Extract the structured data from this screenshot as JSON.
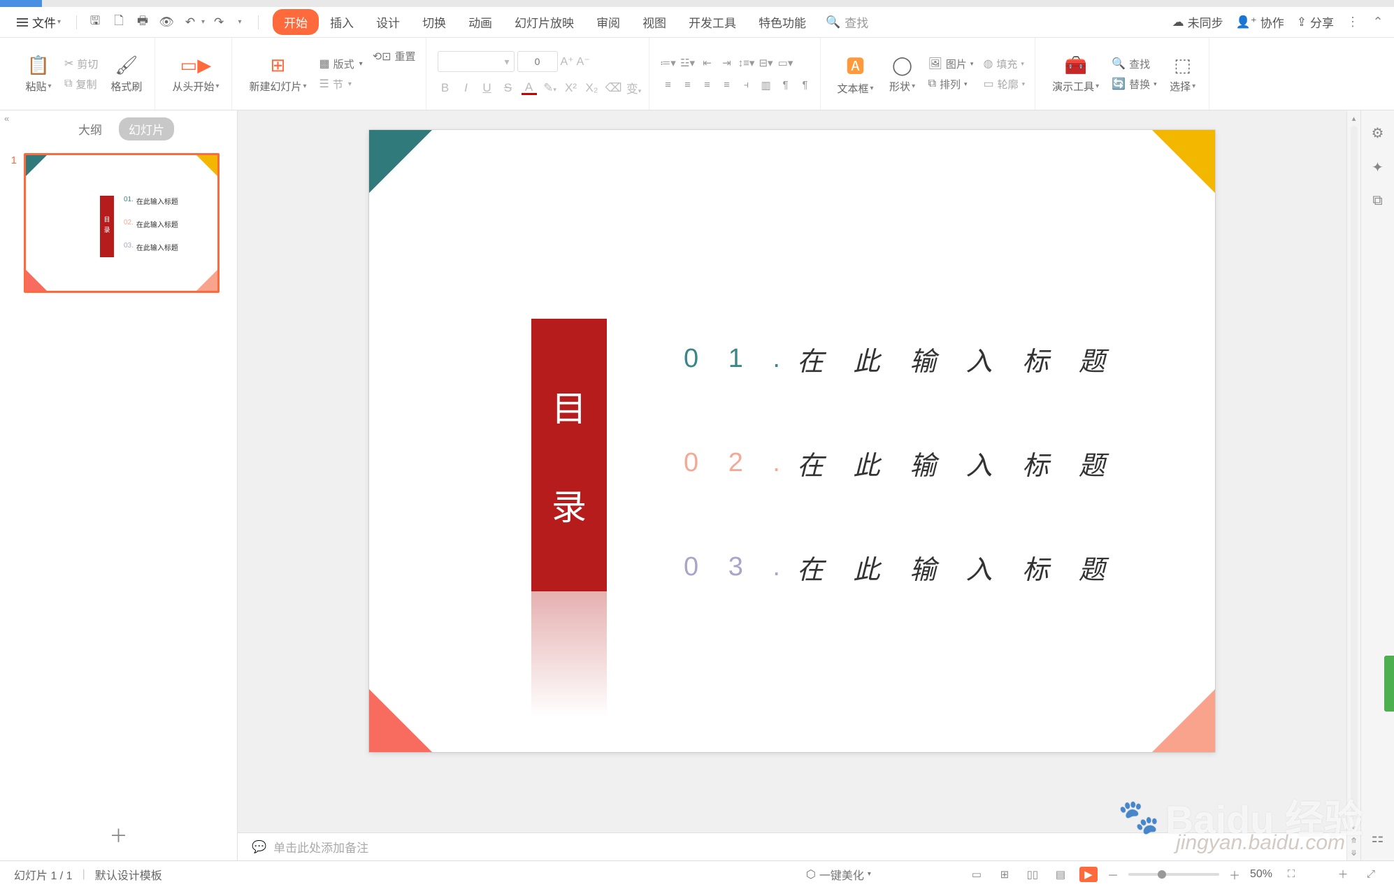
{
  "menu": {
    "file": "文件",
    "tabs": [
      "开始",
      "插入",
      "设计",
      "切换",
      "动画",
      "幻灯片放映",
      "审阅",
      "视图",
      "开发工具",
      "特色功能"
    ],
    "search_placeholder": "查找"
  },
  "top_right": {
    "unsync": "未同步",
    "collab": "协作",
    "share": "分享"
  },
  "ribbon": {
    "paste": "粘贴",
    "cut": "剪切",
    "copy": "复制",
    "format_painter": "格式刷",
    "start_from": "从头开始",
    "new_slide": "新建幻灯片",
    "layout": "版式",
    "section": "节",
    "reset": "重置",
    "font_size_ph": "0",
    "textbox": "文本框",
    "shape": "形状",
    "picture": "图片",
    "arrange": "排列",
    "fill": "填充",
    "outline": "轮廓",
    "present_tools": "演示工具",
    "replace": "替换",
    "find": "查找",
    "select": "选择"
  },
  "panel": {
    "tab_outline": "大纲",
    "tab_slides": "幻灯片"
  },
  "thumb": {
    "num": "1",
    "toc_char1": "目",
    "toc_char2": "录",
    "l1n": "01.",
    "l2n": "02.",
    "l3n": "03.",
    "ltxt": "在此输入标题"
  },
  "slide": {
    "toc_char1": "目",
    "toc_char2": "录",
    "l1n": "0 1 .",
    "l2n": "0 2 .",
    "l3n": "0 3 .",
    "l1t": "在 此 输 入 标 题",
    "l2t": "在 此 输 入 标 题",
    "l3t": "在 此 输 入 标 题"
  },
  "notes": {
    "placeholder": "单击此处添加备注"
  },
  "status": {
    "slide_count": "幻灯片 1 / 1",
    "template": "默认设计模板",
    "beautify": "一键美化",
    "zoom": "50%"
  },
  "watermark": {
    "brand": "Baidu 经验",
    "url": "jingyan.baidu.com"
  }
}
